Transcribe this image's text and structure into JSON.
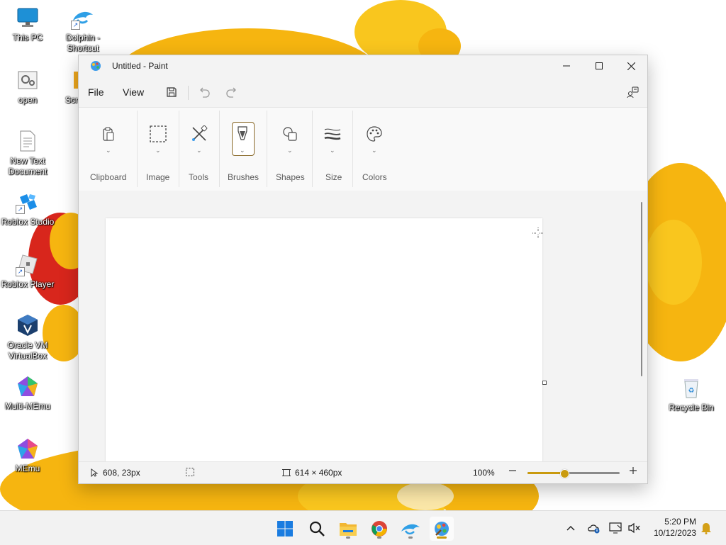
{
  "desktop": {
    "icons": [
      {
        "label": "This PC"
      },
      {
        "label": "Dolphin -\nShortcut"
      },
      {
        "label": "open"
      },
      {
        "label": "Scr"
      },
      {
        "label": "New Text\nDocument"
      },
      {
        "label": "Roblox Studio"
      },
      {
        "label": "Roblox Player"
      },
      {
        "label": "Oracle VM\nVirtualBox"
      },
      {
        "label": "Multi-MEmu"
      },
      {
        "label": "MEmu"
      },
      {
        "label": "Recycle Bin"
      }
    ]
  },
  "window": {
    "title": "Untitled - Paint",
    "menu": {
      "file": "File",
      "view": "View"
    },
    "ribbon": {
      "groups": [
        {
          "label": "Clipboard",
          "icon": "clipboard-icon"
        },
        {
          "label": "Image",
          "icon": "selection-icon"
        },
        {
          "label": "Tools",
          "icon": "tools-icon"
        },
        {
          "label": "Brushes",
          "icon": "brush-icon"
        },
        {
          "label": "Shapes",
          "icon": "shapes-icon"
        },
        {
          "label": "Size",
          "icon": "size-icon"
        },
        {
          "label": "Colors",
          "icon": "palette-icon"
        }
      ]
    },
    "status": {
      "cursor_position": "608, 23px",
      "canvas_size": "614 × 460px",
      "zoom": "100%",
      "zoom_level": 0.4
    }
  },
  "taskbar": {
    "apps": [
      "start-icon",
      "search-icon",
      "file-explorer-icon",
      "chrome-icon",
      "dolphin-icon",
      "paint-icon"
    ],
    "time": "5:20 PM",
    "date": "10/12/2023"
  },
  "colors": {
    "accent": "#c99a0e",
    "wallpaper_yellow": "#f6b510",
    "wallpaper_red": "#d8261c"
  }
}
